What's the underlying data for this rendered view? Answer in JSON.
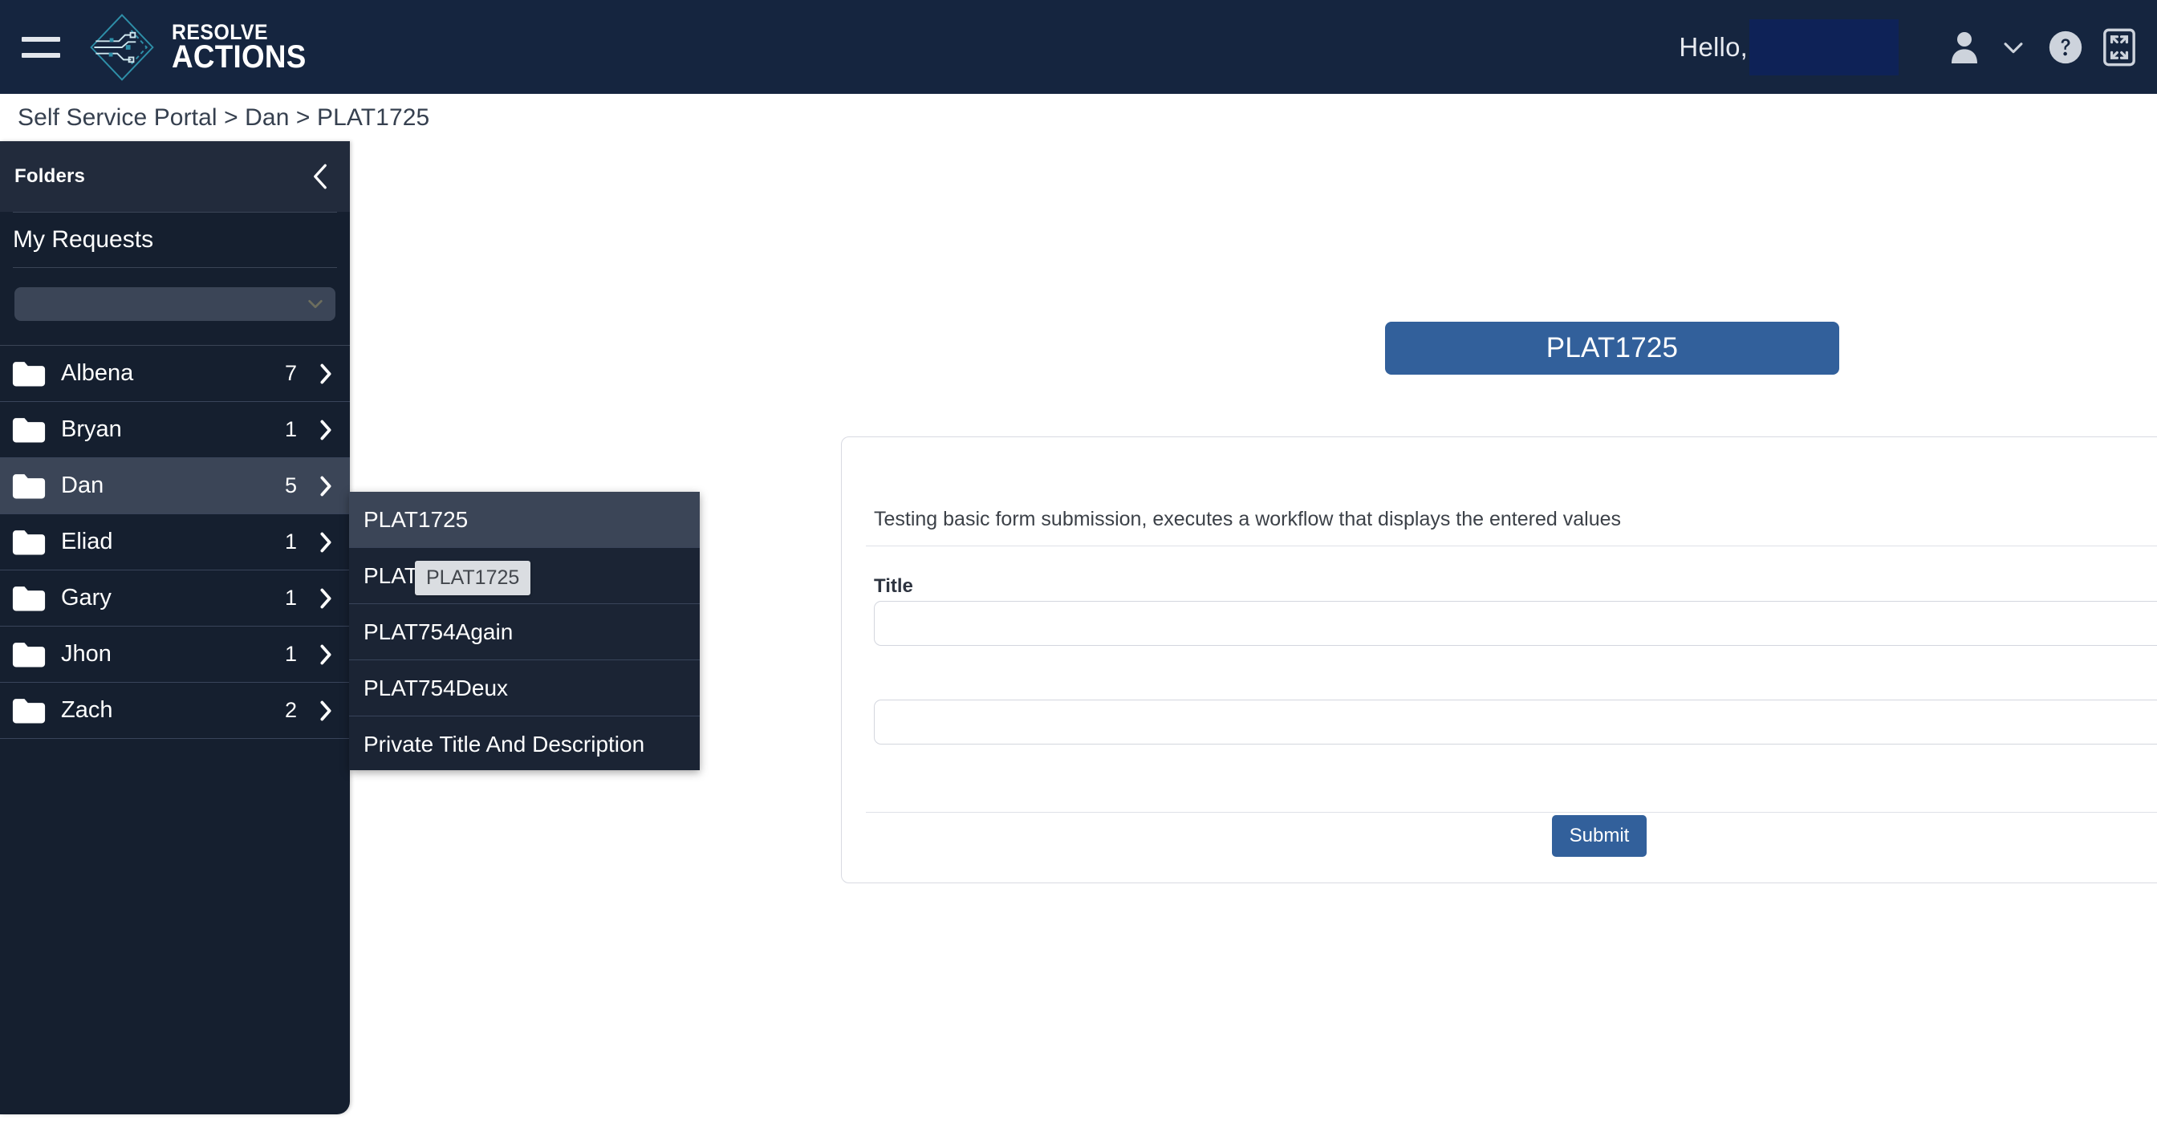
{
  "topbar": {
    "menu_icon": "hamburger-icon",
    "brand_line1": "RESOLVE",
    "brand_line2": "ACTIONS",
    "logo_icon": "resolve-diamond-circuit-logo",
    "greeting": "Hello,",
    "greeting_redacted": true,
    "user_icon": "user-icon",
    "chevron_icon": "chevron-down-icon",
    "help_icon": "help-circle-icon",
    "expand_icon": "fullscreen-expand-icon",
    "background_color": "#15253f"
  },
  "breadcrumb": {
    "text": "Self Service Portal > Dan > PLAT1725"
  },
  "sidebar": {
    "title": "Folders",
    "collapse_icon": "chevron-left-icon",
    "my_requests_label": "My Requests",
    "picker": {
      "value": "",
      "placeholder": "",
      "icon": "chevron-down-icon"
    },
    "folders": [
      {
        "name": "Albena",
        "count": "7",
        "active": false
      },
      {
        "name": "Bryan",
        "count": "1",
        "active": false
      },
      {
        "name": "Dan",
        "count": "5",
        "active": true
      },
      {
        "name": "Eliad",
        "count": "1",
        "active": false
      },
      {
        "name": "Gary",
        "count": "1",
        "active": false
      },
      {
        "name": "Jhon",
        "count": "1",
        "active": false
      },
      {
        "name": "Zach",
        "count": "2",
        "active": false
      }
    ],
    "background_color": "#151f2f",
    "active_color": "#3b4557"
  },
  "flyout": {
    "items": [
      {
        "label": "PLAT1725",
        "active": true
      },
      {
        "label": "PLAT",
        "active": false
      },
      {
        "label": "PLAT754Again",
        "active": false
      },
      {
        "label": "PLAT754Deux",
        "active": false
      },
      {
        "label": "Private Title And Description",
        "active": false
      }
    ],
    "tooltip": "PLAT1725"
  },
  "main": {
    "page_title": "PLAT1725",
    "title_pill_color": "#32609b",
    "card": {
      "close_icon": "close-x-icon",
      "description": "Testing basic form submission, executes a workflow that displays the entered values",
      "fields": [
        {
          "label": "Title",
          "value": "",
          "placeholder": ""
        },
        {
          "label": "",
          "value": "",
          "placeholder": ""
        }
      ],
      "submit_label": "Submit",
      "submit_color": "#32609b"
    }
  }
}
